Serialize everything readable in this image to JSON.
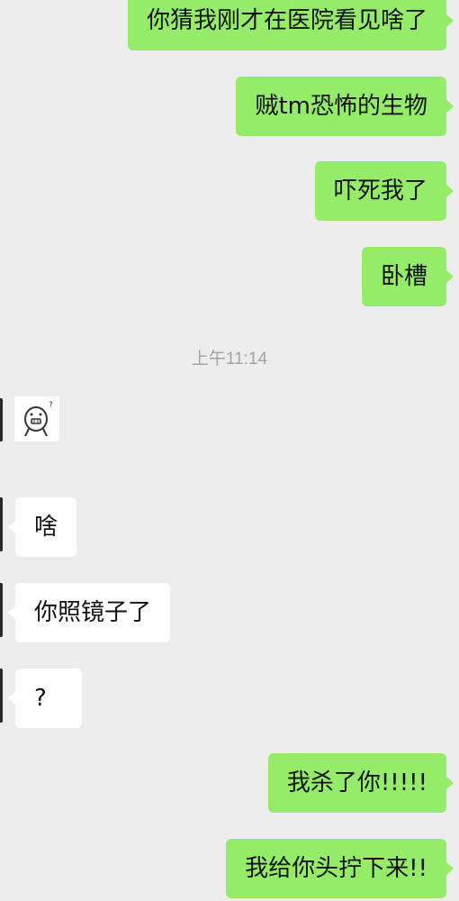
{
  "messages": [
    {
      "text": "你猜我刚才在医院看见啥了"
    },
    {
      "text": "贼tm恐怖的生物"
    },
    {
      "text": "吓死我了"
    },
    {
      "text": "卧槽"
    },
    {
      "text": "啥"
    },
    {
      "text": "你照镜子了"
    },
    {
      "text": "?"
    },
    {
      "text": "我杀了你!!!!!"
    },
    {
      "text": "我给你头拧下来!!"
    }
  ],
  "timestamp": "上午11:14",
  "sticker": {
    "icon": "confused-face-sticker-icon",
    "mark": "?"
  },
  "colors": {
    "background": "#ededed",
    "outgoing_bubble": "#95ec69",
    "incoming_bubble": "#ffffff",
    "timestamp_text": "#a3a3a3"
  }
}
